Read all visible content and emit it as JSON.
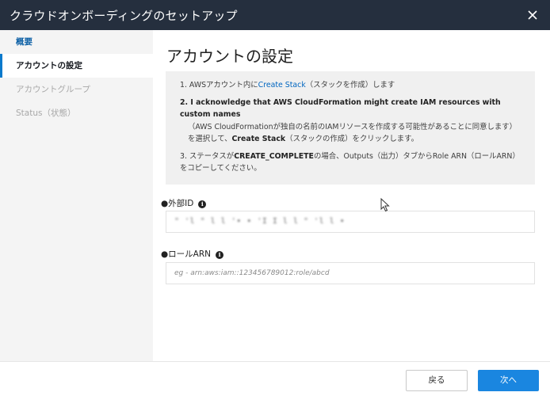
{
  "window": {
    "title": "クラウドオンボーディングのセットアップ",
    "close_icon": "close-icon"
  },
  "sidebar": {
    "items": [
      {
        "label": "概要",
        "state": "completed"
      },
      {
        "label": "アカウントの設定",
        "state": "active"
      },
      {
        "label": "アカウントグループ",
        "state": "disabled"
      },
      {
        "label": "Status（状態）",
        "state": "disabled"
      }
    ]
  },
  "main": {
    "heading": "アカウントの設定",
    "steps": {
      "s1_prefix": "1. AWSアカウント内に",
      "s1_link": "Create Stack",
      "s1_suffix": "（スタックを作成）します",
      "s2_bold": "2. I acknowledge that AWS CloudFormation might create IAM resources with custom names",
      "s2_text": "（AWS CloudFormationが独自の名前のIAMリソースを作成する可能性があることに同意します）を選択して、",
      "s2_bold2": "Create Stack",
      "s2_suffix": "（スタックの作成）をクリックします。",
      "s3_prefix": "3. ステータスが",
      "s3_bold": "CREATE_COMPLETE",
      "s3_suffix": "の場合、Outputs（出力）タブからRole ARN（ロールARN）をコピーしてください。"
    },
    "external_id": {
      "label": "●外部ID",
      "value": "\" 'l \" l l '• • 'I I l l \" 'l l •"
    },
    "role_arn": {
      "label": "●ロールARN",
      "placeholder": "eg - arn:aws:iam::123456789012:role/abcd"
    }
  },
  "footer": {
    "back_label": "戻る",
    "next_label": "次へ"
  },
  "colors": {
    "titlebar": "#252f3e",
    "accent": "#1a86e0",
    "link": "#0066c0",
    "sidebar_bg": "#f4f4f4"
  }
}
